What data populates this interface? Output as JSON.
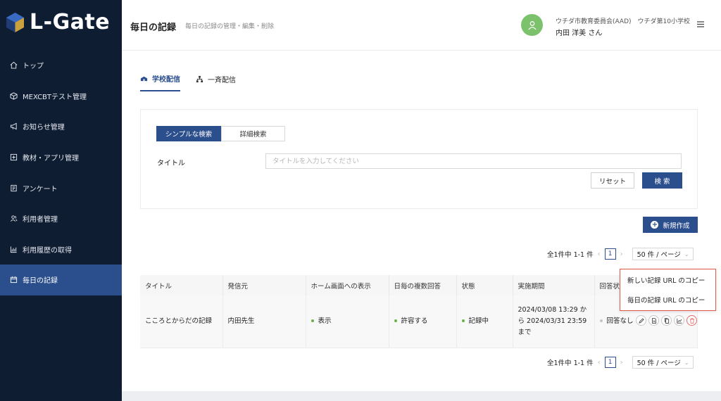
{
  "app": {
    "logo": "L-Gate"
  },
  "sidebar": {
    "items": [
      {
        "label": "トップ",
        "icon": "home-icon"
      },
      {
        "label": "MEXCBTテスト管理",
        "icon": "cube-icon"
      },
      {
        "label": "お知らせ管理",
        "icon": "megaphone-icon"
      },
      {
        "label": "教材・アプリ管理",
        "icon": "plus-box-icon"
      },
      {
        "label": "アンケート",
        "icon": "survey-icon"
      },
      {
        "label": "利用者管理",
        "icon": "users-icon"
      },
      {
        "label": "利用履歴の取得",
        "icon": "bar-chart-icon"
      },
      {
        "label": "毎日の記録",
        "icon": "calendar-icon",
        "active": true
      }
    ]
  },
  "header": {
    "title": "毎日の記録",
    "subtitle": "毎日の記録の管理・編集・削除",
    "org": "ウチダ市教育委員会(AAD)　ウチダ第10小学校",
    "user": "内田 洋美 さん"
  },
  "tabs": [
    {
      "label": "学校配信",
      "active": true
    },
    {
      "label": "一斉配信",
      "active": false
    }
  ],
  "search": {
    "mode_simple": "シンプルな検索",
    "mode_advanced": "詳細検索",
    "title_label": "タイトル",
    "title_placeholder": "タイトルを入力してください",
    "title_value": "",
    "reset": "リセット",
    "submit": "検 索"
  },
  "new_button": "新規作成",
  "pager": {
    "summary": "全1件中 1-1 件",
    "page": "1",
    "page_size": "50 件 / ページ"
  },
  "table": {
    "columns": [
      "タイトル",
      "発信元",
      "ホーム画面への表示",
      "日毎の複数回答",
      "状態",
      "実施期間",
      "回答状況"
    ],
    "rows": [
      {
        "title": "こころとからだの記録",
        "sender": "内田先生",
        "home": "表示",
        "multi": "許容する",
        "status": "記録中",
        "period": "2024/03/08 13:29 から 2024/03/31 23:59 まで",
        "answer": "回答なし"
      }
    ]
  },
  "popup": {
    "items": [
      "新しい記録 URL のコピー",
      "毎日の記録 URL のコピー"
    ]
  },
  "colors": {
    "sidebar": "#0f1d33",
    "accent": "#2b4e8c",
    "active_nav": "#2b4e8c",
    "avatar": "#7cc26c",
    "status_green": "#6ab04c",
    "highlight": "#e05a4a"
  }
}
